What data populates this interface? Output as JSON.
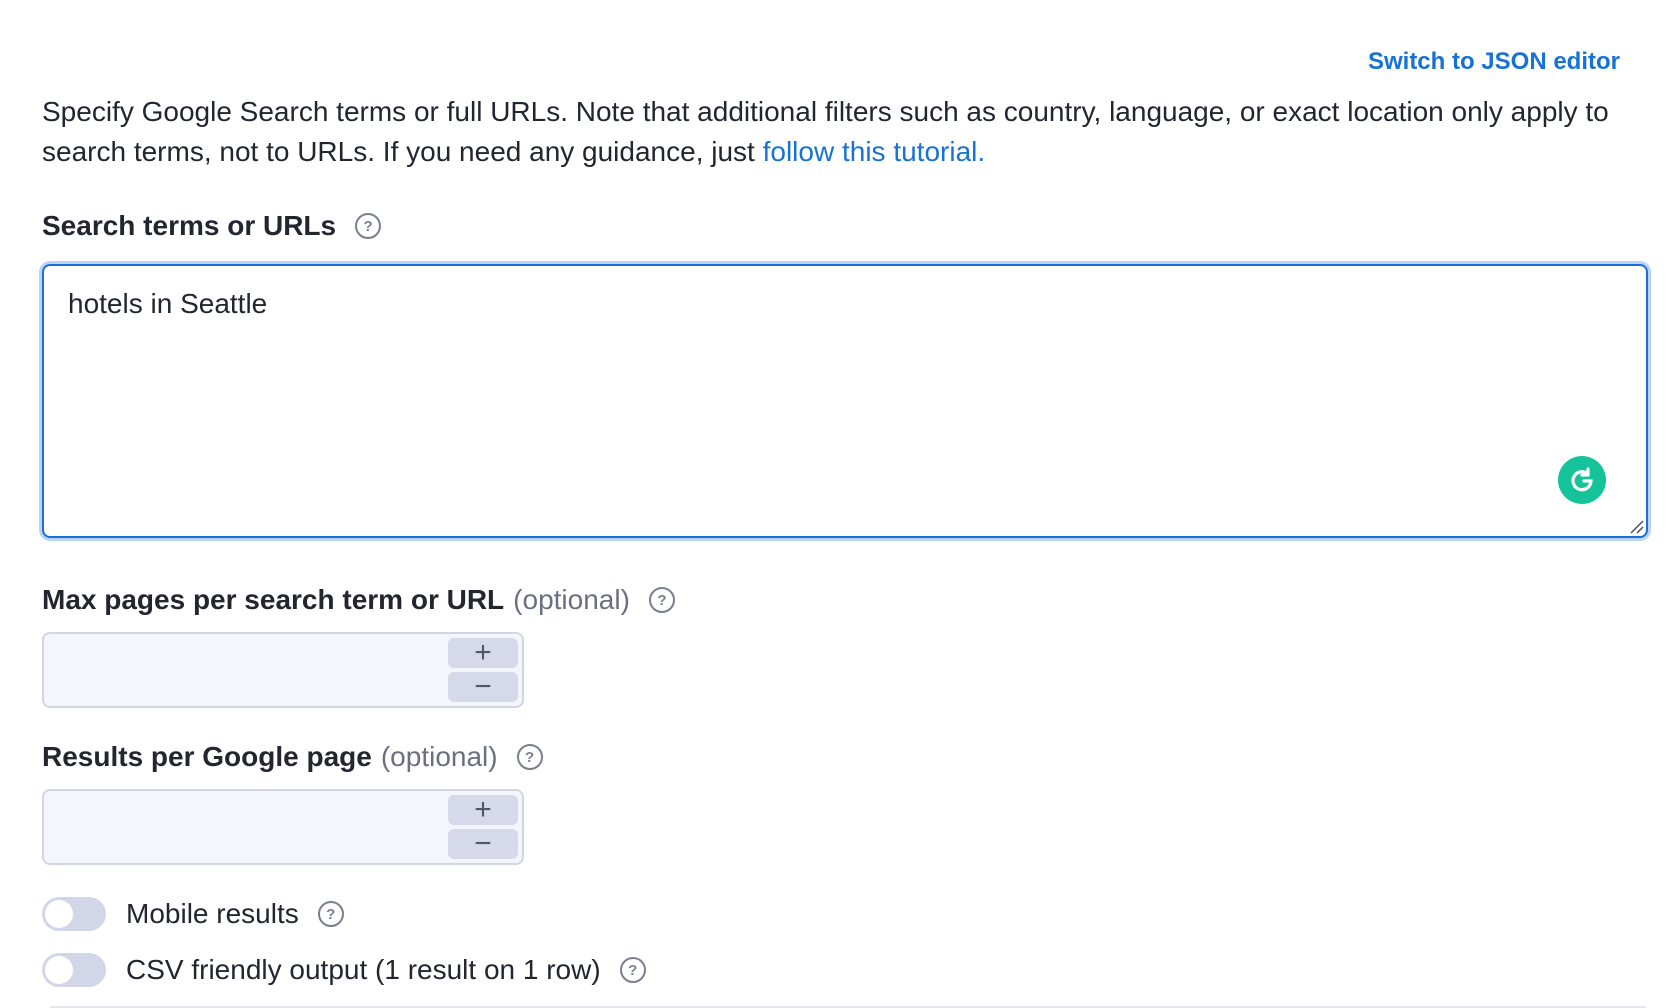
{
  "header": {
    "json_editor_link": "Switch to JSON editor"
  },
  "intro": {
    "text": "Specify Google Search terms or full URLs. Note that additional filters such as country, language, or exact location only apply to search terms, not to URLs. If you need any guidance, just ",
    "tutorial_link": "follow this tutorial."
  },
  "search_terms": {
    "label": "Search terms or URLs",
    "value": "hotels in Seattle"
  },
  "max_pages": {
    "label": "Max pages per search term or URL",
    "optional": "(optional)",
    "value": "",
    "plus": "+",
    "minus": "−"
  },
  "results_per_page": {
    "label": "Results per Google page",
    "optional": "(optional)",
    "value": "",
    "plus": "+",
    "minus": "−"
  },
  "toggles": [
    {
      "label": "Mobile results",
      "checked": false
    },
    {
      "label": "CSV friendly output (1 result on 1 row)",
      "checked": false
    }
  ],
  "help_glyph": "?",
  "colors": {
    "link": "#1672d4",
    "focus_border": "#1b6ed6",
    "grammarly": "#15c39a",
    "toggle_off": "#d3d6e8"
  }
}
